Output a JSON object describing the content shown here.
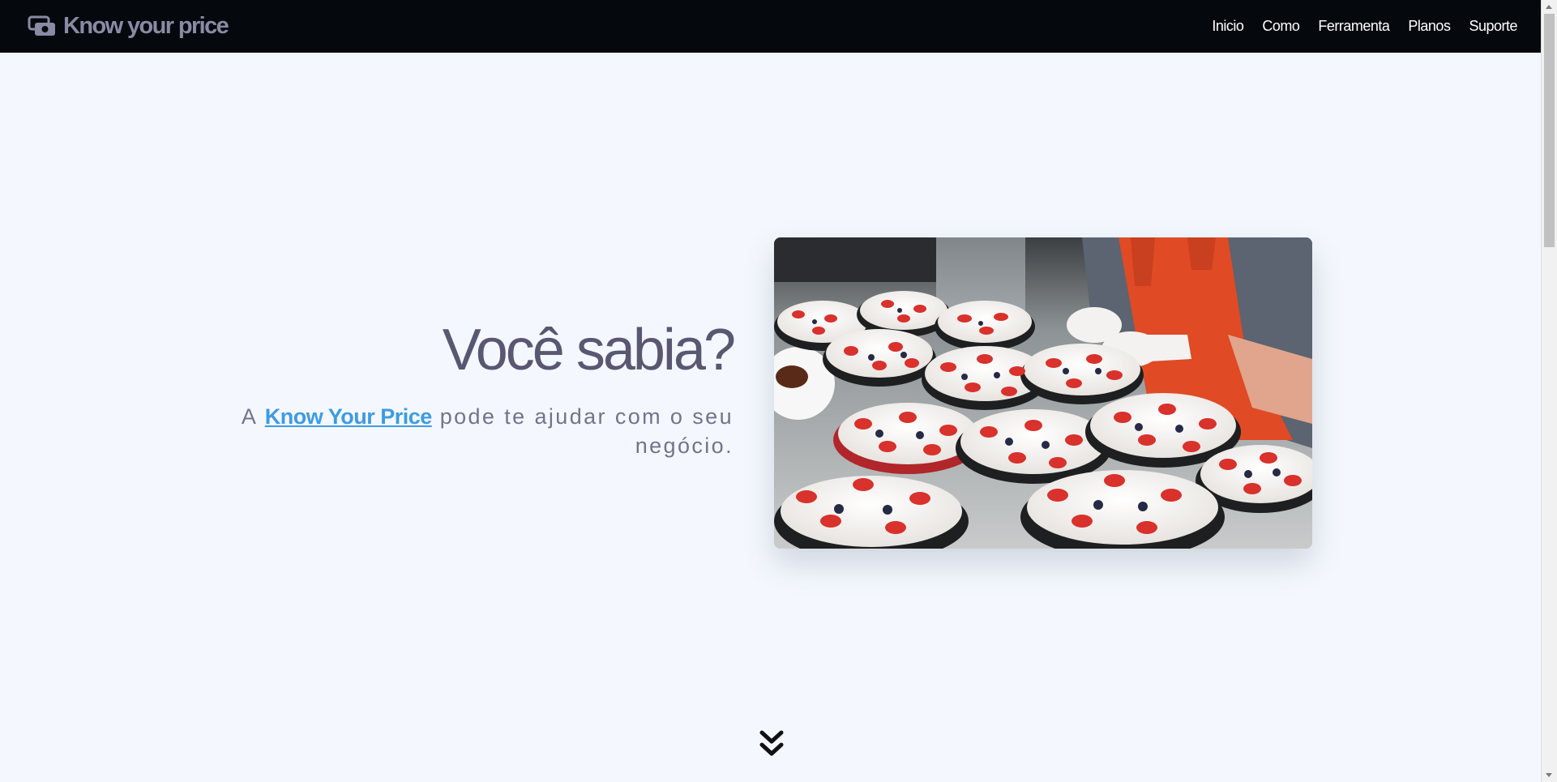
{
  "nav": {
    "brand": "Know your price",
    "brand_icon": "cash-icon",
    "links": [
      "Inicio",
      "Como",
      "Ferramenta",
      "Planos",
      "Suporte"
    ]
  },
  "hero": {
    "title": "Você sabia?",
    "subtitle_prefix": "A",
    "subtitle_link": "Know Your Price",
    "subtitle_suffix": "pode te ajudar com o seu negócio.",
    "image_alt": "dessert-tarts-photo"
  },
  "scroll_down_icon": "double-chevron-down-icon",
  "colors": {
    "navbar_bg": "#05080d",
    "brand": "#8b8aa5",
    "page_bg": "#f4f8fe",
    "title": "#5a5772",
    "link": "#3e9be3"
  }
}
